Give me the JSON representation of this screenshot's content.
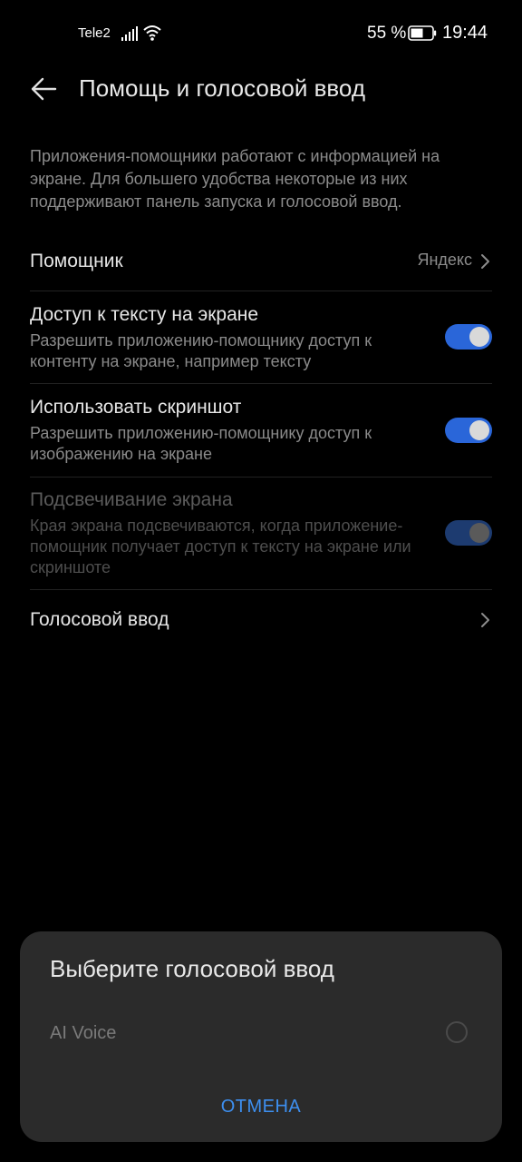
{
  "status_bar": {
    "carrier": "Tele2",
    "battery_percent": "55 %",
    "time": "19:44",
    "icons": [
      "signal-icon",
      "wifi-icon",
      "battery-icon"
    ]
  },
  "header": {
    "back_icon": "back-arrow-icon",
    "title": "Помощь и голосовой ввод"
  },
  "description": "Приложения-помощники работают с информацией на экране. Для большего удобства некоторые из них поддерживают панель запуска и голосовой ввод.",
  "settings": {
    "assistant": {
      "title": "Помощник",
      "value": "Яндекс"
    },
    "screen_text": {
      "title": "Доступ к тексту на экране",
      "subtitle": "Разрешить приложению-помощнику доступ к контенту на экране, например тексту",
      "enabled": true
    },
    "screenshot": {
      "title": "Использовать скриншот",
      "subtitle": "Разрешить приложению-помощнику доступ к изображению на экране",
      "enabled": true
    },
    "flash_screen": {
      "title": "Подсвечивание экрана",
      "subtitle": "Края экрана подсвечиваются, когда приложение-помощник получает доступ к тексту на экране или скриншоте",
      "enabled": true,
      "disabled_state": true
    },
    "voice_input": {
      "title": "Голосовой ввод"
    }
  },
  "dialog": {
    "title": "Выберите голосовой ввод",
    "options": [
      {
        "label": "AI Voice",
        "selected": false
      }
    ],
    "cancel_label": "ОТМЕНА"
  },
  "colors": {
    "accent": "#2a66d9",
    "link": "#3d8ff0",
    "background": "#000000",
    "dialog_background": "#2b2b2b"
  }
}
